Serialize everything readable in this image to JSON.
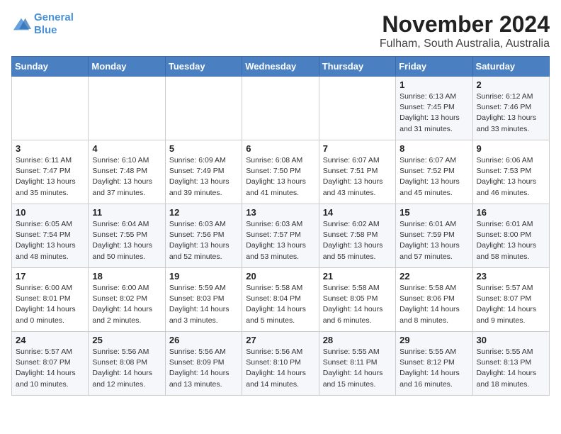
{
  "logo": {
    "line1": "General",
    "line2": "Blue"
  },
  "title": "November 2024",
  "subtitle": "Fulham, South Australia, Australia",
  "header_days": [
    "Sunday",
    "Monday",
    "Tuesday",
    "Wednesday",
    "Thursday",
    "Friday",
    "Saturday"
  ],
  "weeks": [
    [
      {
        "day": "",
        "info": ""
      },
      {
        "day": "",
        "info": ""
      },
      {
        "day": "",
        "info": ""
      },
      {
        "day": "",
        "info": ""
      },
      {
        "day": "",
        "info": ""
      },
      {
        "day": "1",
        "info": "Sunrise: 6:13 AM\nSunset: 7:45 PM\nDaylight: 13 hours\nand 31 minutes."
      },
      {
        "day": "2",
        "info": "Sunrise: 6:12 AM\nSunset: 7:46 PM\nDaylight: 13 hours\nand 33 minutes."
      }
    ],
    [
      {
        "day": "3",
        "info": "Sunrise: 6:11 AM\nSunset: 7:47 PM\nDaylight: 13 hours\nand 35 minutes."
      },
      {
        "day": "4",
        "info": "Sunrise: 6:10 AM\nSunset: 7:48 PM\nDaylight: 13 hours\nand 37 minutes."
      },
      {
        "day": "5",
        "info": "Sunrise: 6:09 AM\nSunset: 7:49 PM\nDaylight: 13 hours\nand 39 minutes."
      },
      {
        "day": "6",
        "info": "Sunrise: 6:08 AM\nSunset: 7:50 PM\nDaylight: 13 hours\nand 41 minutes."
      },
      {
        "day": "7",
        "info": "Sunrise: 6:07 AM\nSunset: 7:51 PM\nDaylight: 13 hours\nand 43 minutes."
      },
      {
        "day": "8",
        "info": "Sunrise: 6:07 AM\nSunset: 7:52 PM\nDaylight: 13 hours\nand 45 minutes."
      },
      {
        "day": "9",
        "info": "Sunrise: 6:06 AM\nSunset: 7:53 PM\nDaylight: 13 hours\nand 46 minutes."
      }
    ],
    [
      {
        "day": "10",
        "info": "Sunrise: 6:05 AM\nSunset: 7:54 PM\nDaylight: 13 hours\nand 48 minutes."
      },
      {
        "day": "11",
        "info": "Sunrise: 6:04 AM\nSunset: 7:55 PM\nDaylight: 13 hours\nand 50 minutes."
      },
      {
        "day": "12",
        "info": "Sunrise: 6:03 AM\nSunset: 7:56 PM\nDaylight: 13 hours\nand 52 minutes."
      },
      {
        "day": "13",
        "info": "Sunrise: 6:03 AM\nSunset: 7:57 PM\nDaylight: 13 hours\nand 53 minutes."
      },
      {
        "day": "14",
        "info": "Sunrise: 6:02 AM\nSunset: 7:58 PM\nDaylight: 13 hours\nand 55 minutes."
      },
      {
        "day": "15",
        "info": "Sunrise: 6:01 AM\nSunset: 7:59 PM\nDaylight: 13 hours\nand 57 minutes."
      },
      {
        "day": "16",
        "info": "Sunrise: 6:01 AM\nSunset: 8:00 PM\nDaylight: 13 hours\nand 58 minutes."
      }
    ],
    [
      {
        "day": "17",
        "info": "Sunrise: 6:00 AM\nSunset: 8:01 PM\nDaylight: 14 hours\nand 0 minutes."
      },
      {
        "day": "18",
        "info": "Sunrise: 6:00 AM\nSunset: 8:02 PM\nDaylight: 14 hours\nand 2 minutes."
      },
      {
        "day": "19",
        "info": "Sunrise: 5:59 AM\nSunset: 8:03 PM\nDaylight: 14 hours\nand 3 minutes."
      },
      {
        "day": "20",
        "info": "Sunrise: 5:58 AM\nSunset: 8:04 PM\nDaylight: 14 hours\nand 5 minutes."
      },
      {
        "day": "21",
        "info": "Sunrise: 5:58 AM\nSunset: 8:05 PM\nDaylight: 14 hours\nand 6 minutes."
      },
      {
        "day": "22",
        "info": "Sunrise: 5:58 AM\nSunset: 8:06 PM\nDaylight: 14 hours\nand 8 minutes."
      },
      {
        "day": "23",
        "info": "Sunrise: 5:57 AM\nSunset: 8:07 PM\nDaylight: 14 hours\nand 9 minutes."
      }
    ],
    [
      {
        "day": "24",
        "info": "Sunrise: 5:57 AM\nSunset: 8:07 PM\nDaylight: 14 hours\nand 10 minutes."
      },
      {
        "day": "25",
        "info": "Sunrise: 5:56 AM\nSunset: 8:08 PM\nDaylight: 14 hours\nand 12 minutes."
      },
      {
        "day": "26",
        "info": "Sunrise: 5:56 AM\nSunset: 8:09 PM\nDaylight: 14 hours\nand 13 minutes."
      },
      {
        "day": "27",
        "info": "Sunrise: 5:56 AM\nSunset: 8:10 PM\nDaylight: 14 hours\nand 14 minutes."
      },
      {
        "day": "28",
        "info": "Sunrise: 5:55 AM\nSunset: 8:11 PM\nDaylight: 14 hours\nand 15 minutes."
      },
      {
        "day": "29",
        "info": "Sunrise: 5:55 AM\nSunset: 8:12 PM\nDaylight: 14 hours\nand 16 minutes."
      },
      {
        "day": "30",
        "info": "Sunrise: 5:55 AM\nSunset: 8:13 PM\nDaylight: 14 hours\nand 18 minutes."
      }
    ]
  ]
}
